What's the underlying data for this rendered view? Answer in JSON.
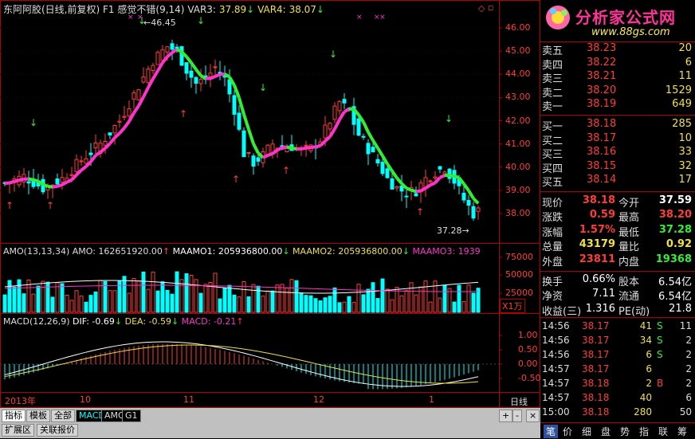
{
  "main_header": {
    "title": "东阿阿胶(日线,前复权)",
    "f1_label": "F1",
    "indicator": "感觉不错(9,14)",
    "var3_label": "VAR3:",
    "var3_value": "37.89",
    "var4_label": "VAR4:",
    "var4_value": "38.07"
  },
  "price_axis": [
    "46.00",
    "45.00",
    "44.00",
    "43.00",
    "42.00",
    "41.00",
    "40.00",
    "39.00",
    "38.00"
  ],
  "annotations": {
    "high_mark": "46.45",
    "low_mark": "37.28"
  },
  "amo_header": {
    "amo_name": "AMO(13,13,34)",
    "amo_value": "AMO: 162651920.00",
    "maamo1": "MAAMO1: 205936800.00",
    "maamo2": "MAAMO2: 205936800.00",
    "maamo3": "MAAMO3: 1939"
  },
  "amo_axis": [
    "75000",
    "50000",
    "25000"
  ],
  "amo_unit": "X1万",
  "macd_header": {
    "name": "MACD(12,26,9)",
    "dif": "DIF: -0.69",
    "dea": "DEA: -0.59",
    "macd": "MACD: -0.21"
  },
  "macd_axis": [
    "1.00",
    "0.50",
    "0.00",
    "-0.50"
  ],
  "date_axis": [
    "2013年",
    "10",
    "11",
    "12",
    "1"
  ],
  "period_label": "日线",
  "zoom_buttons": [
    "+",
    "-",
    "×"
  ],
  "bottom_tabs": [
    "指标",
    "模板",
    "全部",
    "MACD",
    "AMO",
    "G1"
  ],
  "bottom_tabs2": [
    "扩展区",
    "关联报价"
  ],
  "logo": {
    "text": "分析家公式网",
    "url": "www.88gs.com"
  },
  "order_book": {
    "sells": [
      {
        "label": "卖五",
        "price": "38.23",
        "vol": "20"
      },
      {
        "label": "卖四",
        "price": "38.22",
        "vol": "6"
      },
      {
        "label": "卖三",
        "price": "38.21",
        "vol": "11"
      },
      {
        "label": "卖二",
        "price": "38.20",
        "vol": "1529"
      },
      {
        "label": "卖一",
        "price": "38.19",
        "vol": "649"
      }
    ],
    "buys": [
      {
        "label": "买一",
        "price": "38.18",
        "vol": "285"
      },
      {
        "label": "买二",
        "price": "38.17",
        "vol": "10"
      },
      {
        "label": "买三",
        "price": "38.16",
        "vol": "33"
      },
      {
        "label": "买四",
        "price": "38.15",
        "vol": "32"
      },
      {
        "label": "买五",
        "price": "38.14",
        "vol": "17"
      }
    ]
  },
  "quote": {
    "xj_label": "现价",
    "xj": "38.18",
    "jk_label": "今开",
    "jk": "37.59",
    "zd_label": "涨跌",
    "zd": "0.59",
    "zg_label": "最高",
    "zg": "38.20",
    "zf_label": "涨幅",
    "zf": "1.57%",
    "zd2_label": "最低",
    "zd2": "37.28",
    "zl_label": "总量",
    "zl": "43179",
    "lb_label": "量比",
    "lb": "0.92",
    "wp_label": "外盘",
    "wp": "23811",
    "np_label": "内盘",
    "np": "19368",
    "hs_label": "换手",
    "hs": "0.66%",
    "gb_label": "股本",
    "gb": "6.54亿",
    "jz_label": "净资",
    "jz": "7.11",
    "lt_label": "流通",
    "lt": "6.54亿",
    "sy_label": "收益(三)",
    "sy": "1.316",
    "pe_label": "PE(动)",
    "pe": "21.8"
  },
  "ticks": [
    {
      "time": "14:56",
      "price": "38.17",
      "vol": "41",
      "dir": "S",
      "n": "11"
    },
    {
      "time": "14:56",
      "price": "38.17",
      "vol": "34",
      "dir": "S",
      "n": "2"
    },
    {
      "time": "14:56",
      "price": "38.17",
      "vol": "6",
      "dir": "S",
      "n": "2"
    },
    {
      "time": "14:57",
      "price": "38.17",
      "vol": "6",
      "dir": "",
      "n": "2"
    },
    {
      "time": "14:57",
      "price": "38.18",
      "vol": "2",
      "dir": "B",
      "n": "2"
    },
    {
      "time": "14:57",
      "price": "38.18",
      "vol": "40",
      "dir": "",
      "n": "6"
    },
    {
      "time": "15:00",
      "price": "38.18",
      "vol": "280",
      "dir": "",
      "n": "50"
    }
  ],
  "right_tabs": [
    "笔",
    "价",
    "细",
    "盘",
    "势",
    "指",
    "联",
    "筹"
  ],
  "colors": {
    "up": "#ff3b3b",
    "down": "#00ffff",
    "pink": "#ff33cc",
    "green": "#33ee33",
    "yellow": "#f0e040",
    "grid": "#800000",
    "axis": "#b00000"
  }
}
